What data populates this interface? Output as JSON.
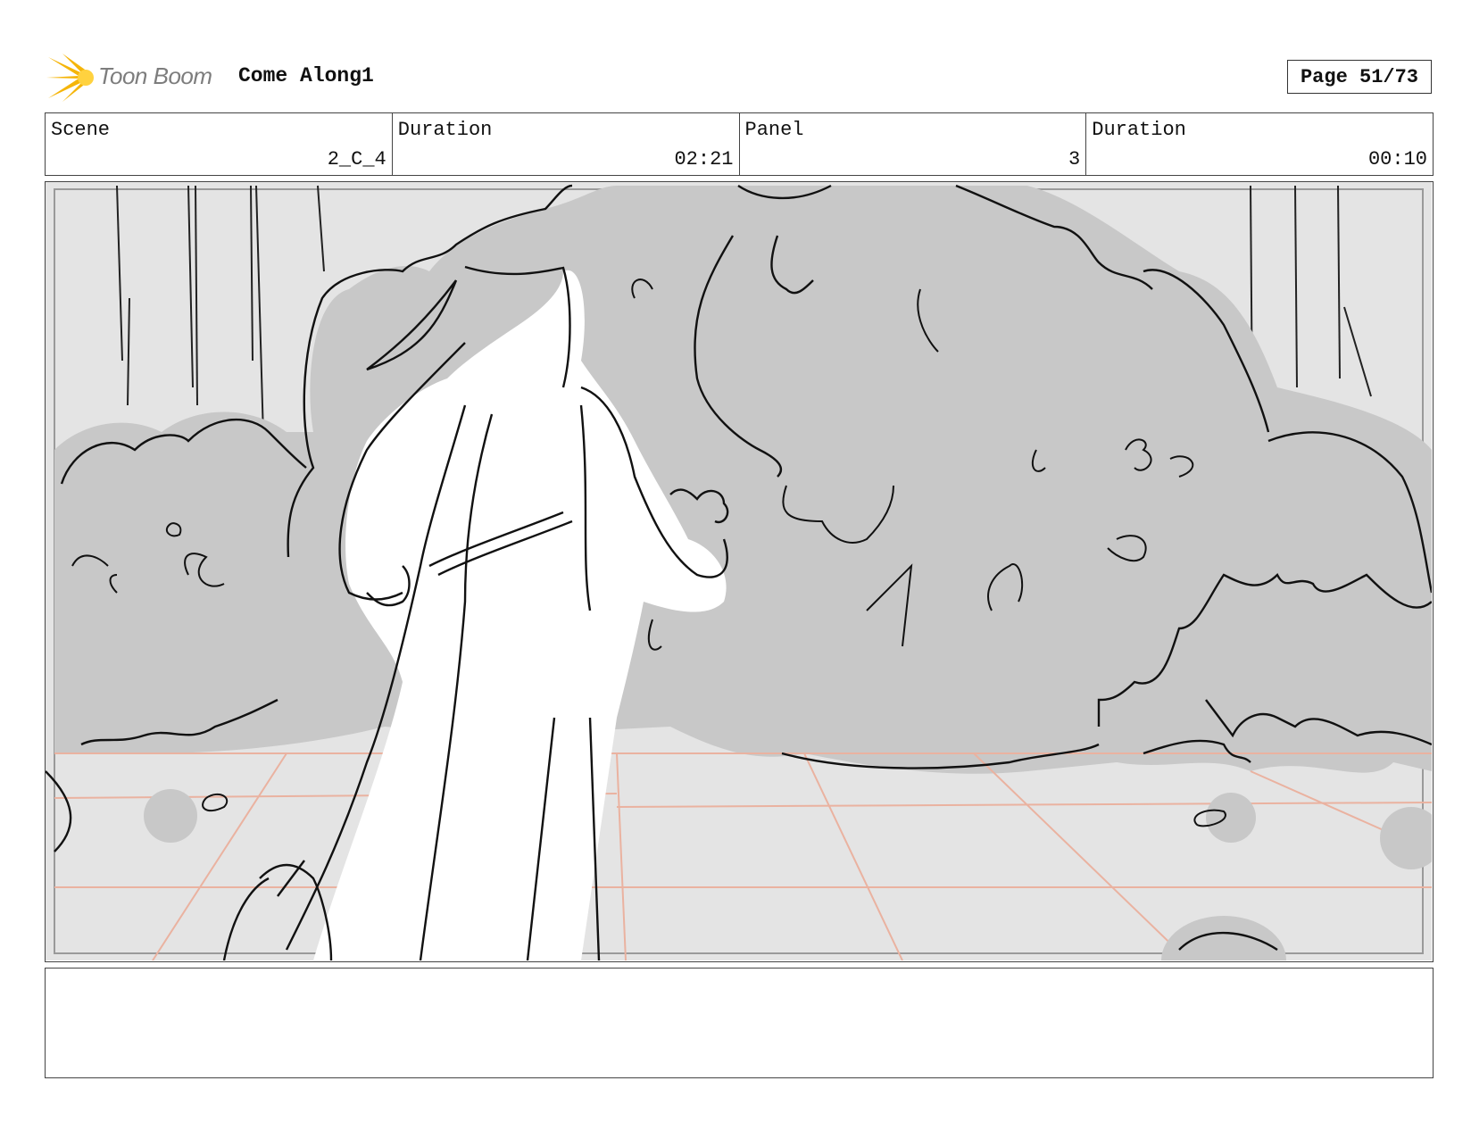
{
  "header": {
    "logo_text": "Toon Boom",
    "project_title": "Come Along1",
    "page_label": "Page 51/73"
  },
  "info_bar": [
    {
      "label": "Scene",
      "value": "2_C_4"
    },
    {
      "label": "Duration",
      "value": "02:21"
    },
    {
      "label": "Panel",
      "value": "3"
    },
    {
      "label": "Duration",
      "value": "00:10"
    }
  ],
  "panel": {
    "image_icon": "storyboard-sketch-forest-figure"
  },
  "notes": {
    "text": ""
  }
}
